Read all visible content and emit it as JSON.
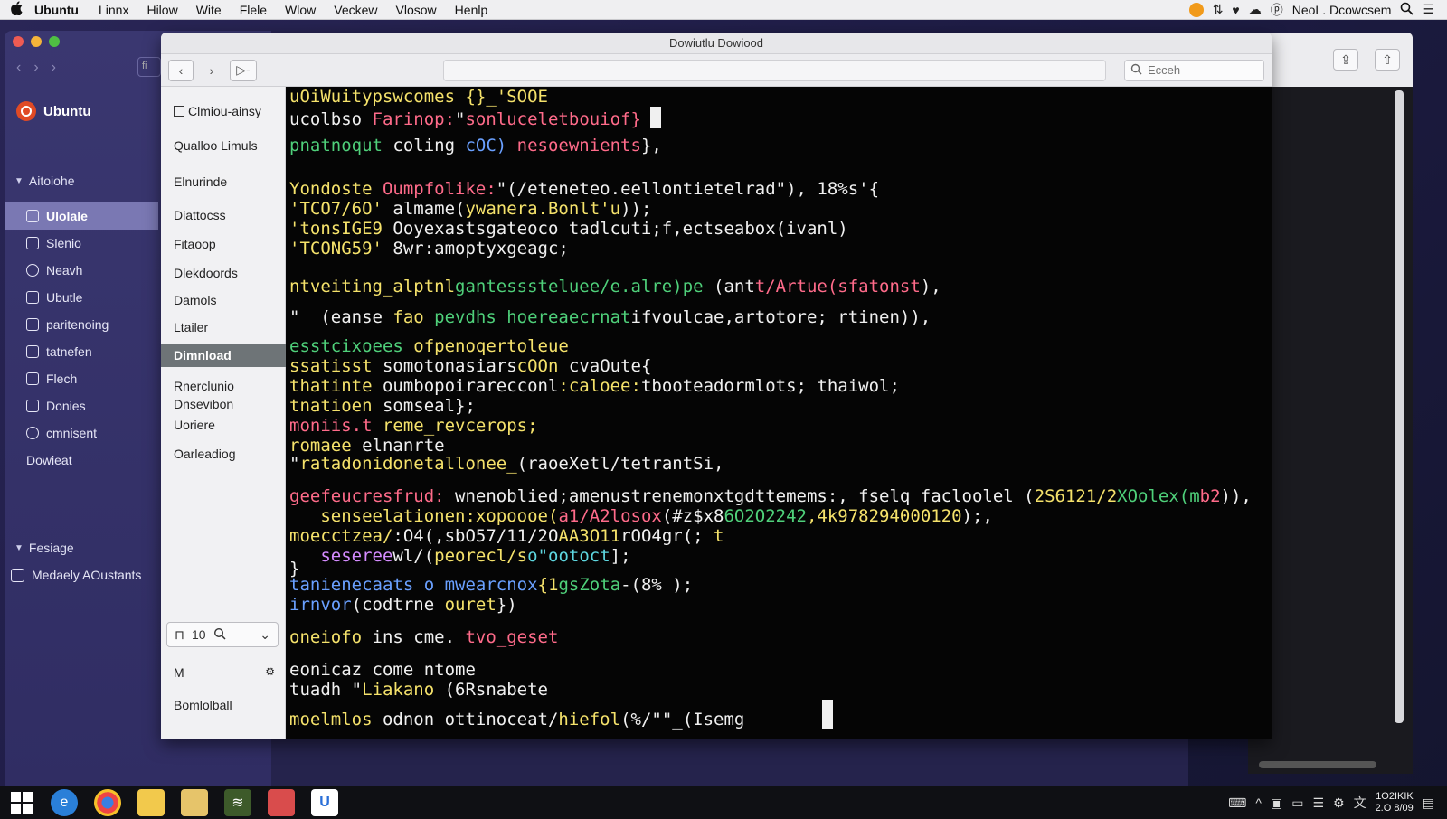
{
  "menubar": {
    "apple": "",
    "items": [
      "Ubuntu",
      "Linnx",
      "Hilow",
      "Wite",
      "Flele",
      "Wlow",
      "Veckew",
      "Vlosow",
      "Henlp"
    ],
    "right_text": "NeoL. Dcowcsem"
  },
  "bg_sidebar": {
    "brand": "Ubuntu",
    "section1": "Aitoiohe",
    "items": [
      {
        "label": "Ulolale",
        "icon": "monitor-icon"
      },
      {
        "label": "Slenio",
        "icon": "document-icon"
      },
      {
        "label": "Neavh",
        "icon": "location-icon"
      },
      {
        "label": "Ubutle",
        "icon": "square-icon"
      },
      {
        "label": "paritenoing",
        "icon": "folder-icon"
      },
      {
        "label": "tatnefen",
        "icon": "download-icon"
      },
      {
        "label": "Flech",
        "icon": "file-icon"
      },
      {
        "label": "Donies",
        "icon": "folder-icon"
      },
      {
        "label": "cmnisent",
        "icon": "gear-icon"
      },
      {
        "label": "Dowieat",
        "icon": ""
      }
    ],
    "section2": "Fesiage",
    "fav": "Medaely AOustants"
  },
  "window": {
    "title": "Dowiutlu Dowiood",
    "search_placeholder": "Ecceh"
  },
  "places": {
    "items": [
      "Clmiou-ainsy",
      "Qualloo Limuls",
      "Elnurinde",
      "Diattocss",
      "Fitaoop",
      "Dlekdoords",
      "Damols",
      "Ltailer",
      "Dimnload",
      "Rnerclunio",
      "Dnsevibon",
      "Uoriere",
      "Oarleadiog"
    ],
    "zoom_value": "10",
    "bottom_items": [
      "M",
      "Bomlolball"
    ]
  },
  "terminal": {
    "lines": [
      {
        "segs": [
          [
            "c-y",
            "uOiWuitypswcomes {}_'SOOE"
          ]
        ]
      },
      {
        "segs": [
          [
            "c-w",
            "ucolbso "
          ],
          [
            "c-r",
            "Farinop:"
          ],
          [
            "c-w",
            "\""
          ],
          [
            "c-r",
            "sonluceletbouiof}"
          ]
        ],
        "cursor": true
      },
      {
        "segs": [
          [
            "c-g",
            "pnatnoqut "
          ],
          [
            "c-w",
            "coling "
          ],
          [
            "c-b",
            "cOC) "
          ],
          [
            "c-r",
            "nesoewnients"
          ],
          [
            "c-w",
            "},"
          ]
        ]
      },
      {
        "segs": [
          [
            "c-y",
            "Yondoste "
          ],
          [
            "c-r",
            "Oumpfolike:"
          ],
          [
            "c-w",
            "\"(/eteneteo.eellontietelrad\"), 18%s'{"
          ]
        ]
      },
      {
        "segs": [
          [
            "c-y",
            "'TCO7/6O' "
          ],
          [
            "c-w",
            "almame("
          ],
          [
            "c-y",
            "ywanera.Bonlt'u"
          ],
          [
            "c-w",
            "));"
          ]
        ]
      },
      {
        "segs": [
          [
            "c-y",
            "'tonsIGE9 "
          ],
          [
            "c-w",
            "Ooyexastsgateoco tadlcuti;f,ectseabox(ivanl)"
          ]
        ]
      },
      {
        "segs": [
          [
            "c-y",
            "'TCONG59' "
          ],
          [
            "c-w",
            "8wr:amoptyxgeagc;"
          ]
        ]
      },
      {
        "segs": [
          [
            "c-y",
            "ntveiting_alptnl"
          ],
          [
            "c-g",
            "gantesssteluee/e.alre)pe "
          ],
          [
            "c-w",
            "(ant"
          ],
          [
            "c-r",
            "t/Artue(sfatonst"
          ],
          [
            "c-w",
            "),"
          ]
        ]
      },
      {
        "segs": [
          [
            "c-w",
            "\"  (eanse "
          ],
          [
            "c-y",
            "fao "
          ],
          [
            "c-g",
            "pevdhs hoereaecrnat"
          ],
          [
            "c-w",
            "ifvoulcae,artotore; rtinen)),"
          ]
        ]
      },
      {
        "segs": [
          [
            "c-g",
            "esstcixoees "
          ],
          [
            "c-y",
            "ofpenoqertoleue"
          ]
        ]
      },
      {
        "segs": [
          [
            "c-y",
            "ssatisst "
          ],
          [
            "c-w",
            "somotonasiars"
          ],
          [
            "c-y",
            "cOOn "
          ],
          [
            "c-w",
            "cvaOute{"
          ]
        ]
      },
      {
        "segs": [
          [
            "c-y",
            "thatinte "
          ],
          [
            "c-w",
            "oumbopoirarecconl"
          ],
          [
            "c-y",
            ":caloee:"
          ],
          [
            "c-w",
            "tbooteadormlots; thaiwol;"
          ]
        ]
      },
      {
        "segs": [
          [
            "c-y",
            "tnatioen "
          ],
          [
            "c-w",
            "somseal};"
          ]
        ]
      },
      {
        "segs": [
          [
            "c-r",
            "moniis.t "
          ],
          [
            "c-y",
            "reme_revcerops;"
          ]
        ]
      },
      {
        "segs": [
          [
            "c-y",
            "romaee "
          ],
          [
            "c-w",
            "elnanrte"
          ]
        ]
      },
      {
        "segs": [
          [
            "c-w",
            "\""
          ],
          [
            "c-y",
            "ratadonidonetallonee_"
          ],
          [
            "c-w",
            "(raoeXetl/tetrantSi,"
          ]
        ]
      },
      {
        "segs": [
          [
            "c-r",
            "geefeucresfrud: "
          ],
          [
            "c-w",
            "wnenoblied;amenustrenemonxtgdttemems:, fselq facloolel ("
          ],
          [
            "c-y",
            "2S6121/2"
          ],
          [
            "c-g",
            "XOolex(m"
          ],
          [
            "c-r",
            "b2"
          ],
          [
            "c-w",
            ")),"
          ]
        ]
      },
      {
        "segs": [
          [
            "c-w",
            "   "
          ],
          [
            "c-y",
            "senseelationen:xopoooe("
          ],
          [
            "c-r",
            "a1/A2losox"
          ],
          [
            "c-w",
            "(#z$x8"
          ],
          [
            "c-g",
            "6O2O2242"
          ],
          [
            "c-y",
            ",4k978294000120"
          ],
          [
            "c-w",
            ");,"
          ]
        ]
      },
      {
        "segs": [
          [
            "c-y",
            "moecctzea/"
          ],
          [
            "c-w",
            ":O4(,sbO57/11/2O"
          ],
          [
            "c-y",
            "AA3O11"
          ],
          [
            "c-w",
            "rOO4gr(; "
          ],
          [
            "c-y",
            "t"
          ]
        ]
      },
      {
        "segs": [
          [
            "c-w",
            "   "
          ],
          [
            "c-m",
            "seseree"
          ],
          [
            "c-w",
            "wl/("
          ],
          [
            "c-y",
            "peorecl/s"
          ],
          [
            "c-c",
            "o\"ootoct"
          ],
          [
            "c-w",
            "];"
          ]
        ]
      },
      {
        "segs": [
          [
            "c-w",
            "}"
          ]
        ]
      },
      {
        "segs": [
          [
            "c-b",
            "tanienecaats o mwearcnox"
          ],
          [
            "c-y",
            "{1"
          ],
          [
            "c-g",
            "gsZota"
          ],
          [
            "c-w",
            "-(8%"
          ],
          [
            "c-w",
            " );"
          ]
        ]
      },
      {
        "segs": [
          [
            "c-b",
            "irnvor"
          ],
          [
            "c-w",
            "(codtrne "
          ],
          [
            "c-y",
            "ouret"
          ],
          [
            "c-w",
            "})"
          ]
        ]
      },
      {
        "segs": [
          [
            "c-y",
            "oneiofo "
          ],
          [
            "c-w",
            "ins cme. "
          ],
          [
            "c-r",
            "tvo_geset"
          ]
        ]
      },
      {
        "segs": [
          [
            "c-w",
            "eonicaz come ntome"
          ]
        ]
      },
      {
        "segs": [
          [
            "c-w",
            "tuadh \""
          ],
          [
            "c-y",
            "Liakano "
          ],
          [
            "c-w",
            "(6Rsnabete"
          ]
        ]
      },
      {
        "segs": [
          [
            "c-y",
            "moelmlos "
          ],
          [
            "c-w",
            "odnon ottinoceat/"
          ],
          [
            "c-y",
            "hiefol"
          ],
          [
            "c-w",
            "(%/\"\"_(Isemg"
          ]
        ],
        "cursor_end": true
      }
    ]
  },
  "taskbar": {
    "clock_time": "1O2IKIK",
    "clock_date": "2.O 8/09"
  },
  "colors": {
    "desktop": "#2a2657",
    "terminal_bg": "#050505",
    "active_place": "#6e7477",
    "sidebar_active": "#7a78b3"
  }
}
